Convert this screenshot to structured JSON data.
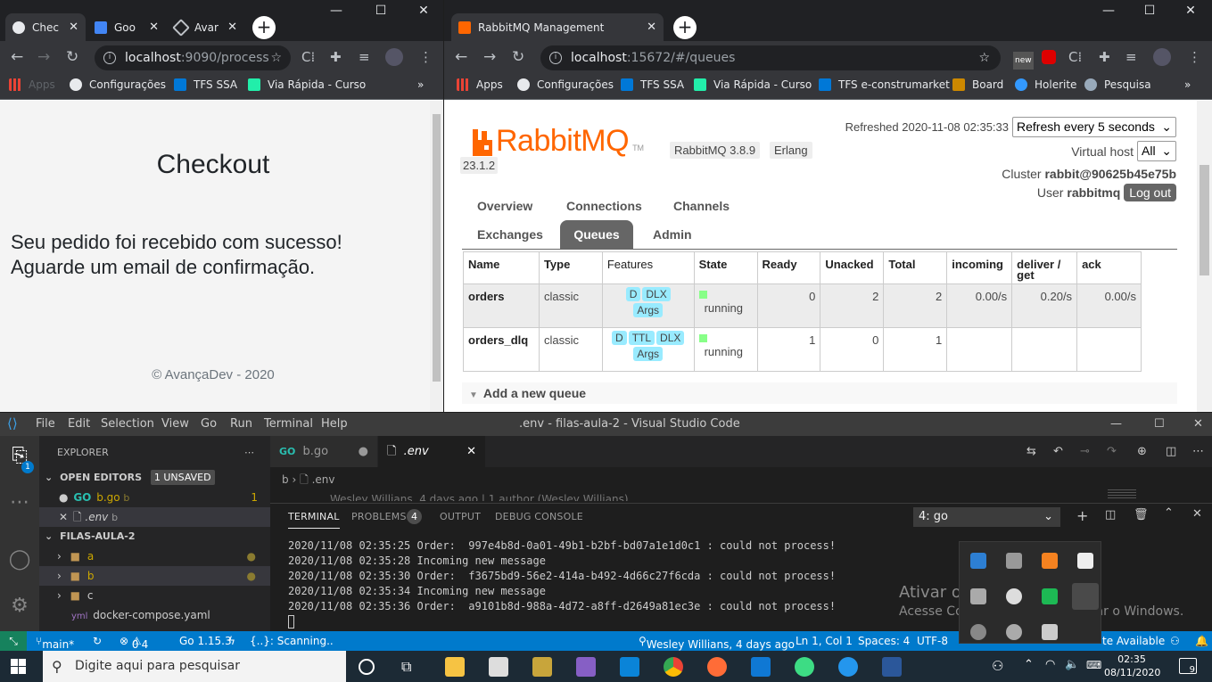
{
  "left_browser": {
    "tabs": [
      {
        "label": "Chec",
        "active": true
      },
      {
        "label": "Goo",
        "active": false
      },
      {
        "label": "Avar",
        "active": false
      }
    ],
    "url_host": "localhost",
    "url_rest": ":9090/process",
    "bookmarks": [
      "Apps",
      "Configurações",
      "TFS SSA",
      "Via Rápida - Curso"
    ],
    "page": {
      "title": "Checkout",
      "message_line1": "Seu pedido foi recebido com sucesso!",
      "message_line2": "Aguarde um email de confirmação.",
      "footer": "© AvançaDev - 2020"
    }
  },
  "right_browser": {
    "tab_label": "RabbitMQ Management",
    "url_host": "localhost",
    "url_rest": ":15672/#/queues",
    "bookmarks": [
      "Apps",
      "Configurações",
      "TFS SSA",
      "Via Rápida - Curso",
      "TFS e-construmarket",
      "Board",
      "Holerite",
      "Pesquisa"
    ],
    "rabbit": {
      "logo_text": "RabbitMQ",
      "logo_tm": "TM",
      "version": "RabbitMQ 3.8.9",
      "erlang_label": "Erlang",
      "erlang_version": "23.1.2",
      "refreshed": "Refreshed 2020-11-08 02:35:33",
      "refresh_select": "Refresh every 5 seconds",
      "vhost_label": "Virtual host",
      "vhost_value": "All",
      "cluster_label": "Cluster",
      "cluster_value": "rabbit@90625b45e75b",
      "user_label": "User",
      "user_value": "rabbitmq",
      "logout": "Log out",
      "nav": [
        "Overview",
        "Connections",
        "Channels",
        "Exchanges",
        "Queues",
        "Admin"
      ],
      "columns": [
        "Name",
        "Type",
        "Features",
        "State",
        "Ready",
        "Unacked",
        "Total",
        "incoming",
        "deliver / get",
        "ack"
      ],
      "queues": [
        {
          "name": "orders",
          "type": "classic",
          "features": [
            "D",
            "DLX",
            "Args"
          ],
          "state": "running",
          "ready": "0",
          "unacked": "2",
          "total": "2",
          "incoming": "0.00/s",
          "deliver": "0.20/s",
          "ack": "0.00/s"
        },
        {
          "name": "orders_dlq",
          "type": "classic",
          "features": [
            "D",
            "TTL",
            "DLX",
            "Args"
          ],
          "state": "running",
          "ready": "1",
          "unacked": "0",
          "total": "1",
          "incoming": "",
          "deliver": "",
          "ack": ""
        }
      ],
      "add_queue": "Add a new queue"
    }
  },
  "vscode": {
    "menu": [
      "File",
      "Edit",
      "Selection",
      "View",
      "Go",
      "Run",
      "Terminal",
      "Help"
    ],
    "title": ".env - filas-aula-2 - Visual Studio Code",
    "explorer_label": "EXPLORER",
    "open_editors": "OPEN EDITORS",
    "unsaved_badge": "1 UNSAVED",
    "open_files": [
      {
        "name": "b.go",
        "folder": "b",
        "badge": "1"
      },
      {
        "name": ".env",
        "folder": "b",
        "badge": ""
      }
    ],
    "project": "FILAS-AULA-2",
    "tree": [
      "a",
      "b",
      "c",
      "docker-compose.yaml"
    ],
    "editor_tabs": [
      "b.go",
      ".env"
    ],
    "breadcrumb_folder": "b",
    "breadcrumb_file": ".env",
    "blame": "Wesley Willians, 4 days ago | 1 author (Wesley Willians)",
    "activity_badge": "1",
    "panel_tabs": [
      "TERMINAL",
      "PROBLEMS",
      "OUTPUT",
      "DEBUG CONSOLE"
    ],
    "problems_count": "4",
    "terminal_select": "4: go",
    "terminal_lines": [
      "2020/11/08 02:35:25 Order:  997e4b8d-0a01-49b1-b2bf-bd07a1e1d0c1 : could not process!",
      "2020/11/08 02:35:28 Incoming new message",
      "2020/11/08 02:35:30 Order:  f3675bd9-56e2-414a-b492-4d66c27f6cda : could not process!",
      "2020/11/08 02:35:34 Incoming new message",
      "2020/11/08 02:35:36 Order:  a9101b8d-988a-4d72-a8ff-d2649a81ec3e : could not process!"
    ],
    "watermark_title": "Ativar o Windows",
    "watermark_sub": "Acesse Configurações para ativar o Windows.",
    "status": {
      "branch": "main*",
      "errors": "0",
      "warnings": "4",
      "go_version": "Go 1.15.3",
      "scanning": "{..}: Scanning..",
      "blame": "Wesley Willians, 4 days ago",
      "position": "Ln 1, Col 1",
      "spaces": "Spaces: 4",
      "encoding": "UTF-8",
      "update": "te Available"
    }
  },
  "taskbar": {
    "search_placeholder": "Digite aqui para pesquisar",
    "time": "02:35",
    "date": "08/11/2020",
    "notifications": "9"
  }
}
